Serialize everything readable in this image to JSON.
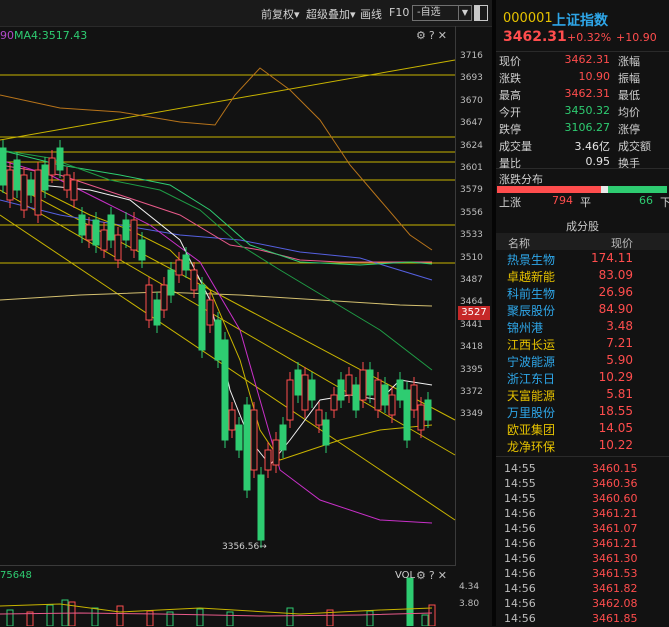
{
  "toolbar": {
    "restore": "前复权▾",
    "overlay": "超级叠加▾",
    "draw": "画线",
    "f10": "F10",
    "custom": "-自选",
    "dropdown_arrow": "▼"
  },
  "main_pane": {
    "ma_partial": "90",
    "ma4": "MA4:3517.43",
    "icons": "⚙?✕",
    "current_price_tag": "3527",
    "low_label": "3356.56→",
    "price_ticks": [
      "3716",
      "3693",
      "3670",
      "3647",
      "3624",
      "3601",
      "3579",
      "3556",
      "3533",
      "3510",
      "3487",
      "3464",
      "3441",
      "3418",
      "3395",
      "3372",
      "3349"
    ]
  },
  "volume_pane": {
    "partial_label": "75648",
    "label": "VOL",
    "icons": "⚙?✕",
    "ticks": [
      "4.34",
      "3.80"
    ]
  },
  "header": {
    "code": "000001",
    "name": "上证指数",
    "price": "3462.31",
    "change_pct": "+0.32%",
    "change": "+10.90"
  },
  "stats": [
    {
      "label": "现价",
      "value": "3462.31",
      "value_color": "#ff4d4d",
      "right": "涨幅"
    },
    {
      "label": "涨跌",
      "value": "10.90",
      "value_color": "#ff4d4d",
      "right": "振幅"
    },
    {
      "label": "最高",
      "value": "3462.31",
      "value_color": "#ff4d4d",
      "right": "最低"
    },
    {
      "label": "今开",
      "value": "3450.32",
      "value_color": "#2ecc71",
      "right": "均价"
    },
    {
      "label": "跌停",
      "value": "3106.27",
      "value_color": "#2ecc71",
      "right": "涨停"
    },
    {
      "label": "成交量",
      "value": "3.46亿",
      "value_color": "#e6e6e6",
      "right": "成交额"
    },
    {
      "label": "量比",
      "value": "0.95",
      "value_color": "#e6e6e6",
      "right": "换手"
    }
  ],
  "distribution": {
    "title": "涨跌分布",
    "up_label": "上涨",
    "up_count": "794",
    "flat_label": "平",
    "down_count": "66",
    "down_label": "下",
    "up_ratio": 0.61,
    "flat_ratio": 0.04,
    "down_ratio": 0.35
  },
  "constituents": {
    "title": "成分股",
    "col_name": "名称",
    "col_price": "现价",
    "rows": [
      {
        "name": "热景生物",
        "price": "174.11",
        "color": "#2ea6e8"
      },
      {
        "name": "卓越新能",
        "price": "83.09",
        "color": "#e6c200"
      },
      {
        "name": "科前生物",
        "price": "26.96",
        "color": "#2ea6e8"
      },
      {
        "name": "聚辰股份",
        "price": "84.90",
        "color": "#2ea6e8"
      },
      {
        "name": "锦州港",
        "price": "3.48",
        "color": "#2ea6e8"
      },
      {
        "name": "江西长运",
        "price": "7.21",
        "color": "#e6c200"
      },
      {
        "name": "宁波能源",
        "price": "5.90",
        "color": "#2ea6e8"
      },
      {
        "name": "浙江东日",
        "price": "10.29",
        "color": "#2ea6e8"
      },
      {
        "name": "天富能源",
        "price": "5.81",
        "color": "#e6c200"
      },
      {
        "name": "万里股份",
        "price": "18.55",
        "color": "#2ea6e8"
      },
      {
        "name": "欧亚集团",
        "price": "14.05",
        "color": "#e6c200"
      },
      {
        "name": "龙净环保",
        "price": "10.22",
        "color": "#e6c200"
      }
    ]
  },
  "ticks": [
    {
      "time": "14:55",
      "price": "3460.15"
    },
    {
      "time": "14:55",
      "price": "3460.36"
    },
    {
      "time": "14:55",
      "price": "3460.60"
    },
    {
      "time": "14:56",
      "price": "3461.21"
    },
    {
      "time": "14:56",
      "price": "3461.07"
    },
    {
      "time": "14:56",
      "price": "3461.21"
    },
    {
      "time": "14:56",
      "price": "3461.30"
    },
    {
      "time": "14:56",
      "price": "3461.53"
    },
    {
      "time": "14:56",
      "price": "3461.82"
    },
    {
      "time": "14:56",
      "price": "3462.08"
    },
    {
      "time": "14:56",
      "price": "3461.85"
    }
  ],
  "colors": {
    "up": "#ff4d4d",
    "down": "#2ecc71",
    "accent_name": "#2ea6e8",
    "code": "#e6c200"
  }
}
